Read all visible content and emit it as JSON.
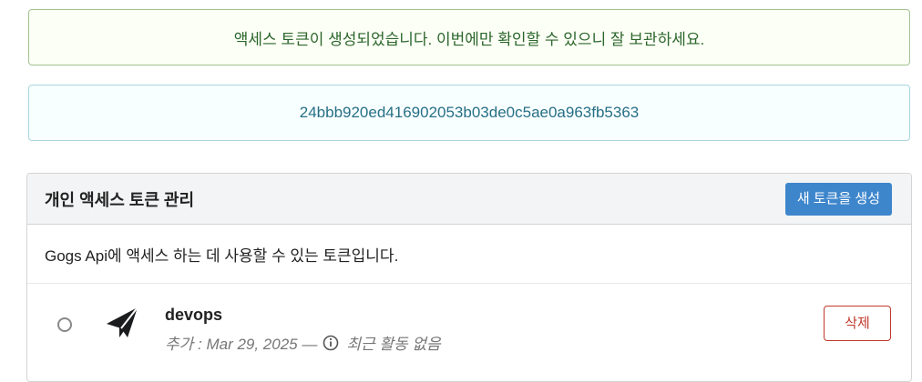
{
  "messages": {
    "success": "액세스 토큰이 생성되었습니다. 이번에만 확인할 수 있으니 잘 보관하세요.",
    "token_value": "24bbb920ed416902053b03de0c5ae0a963fb5363"
  },
  "panel": {
    "title": "개인 액세스 토큰 관리",
    "new_token_button": "새 토큰을 생성",
    "description": "Gogs Api에 액세스 하는 데 사용할 수 있는 토큰입니다."
  },
  "tokens": [
    {
      "name": "devops",
      "added": "추가 : Mar 29, 2025 —",
      "last_activity": "최근 활동 없음",
      "delete_label": "삭제",
      "icon": "paper-plane-icon"
    }
  ],
  "colors": {
    "success_text": "#2c662d",
    "info_text": "#276f86",
    "primary_button": "#3e86cc",
    "delete_button": "#c0392b"
  }
}
